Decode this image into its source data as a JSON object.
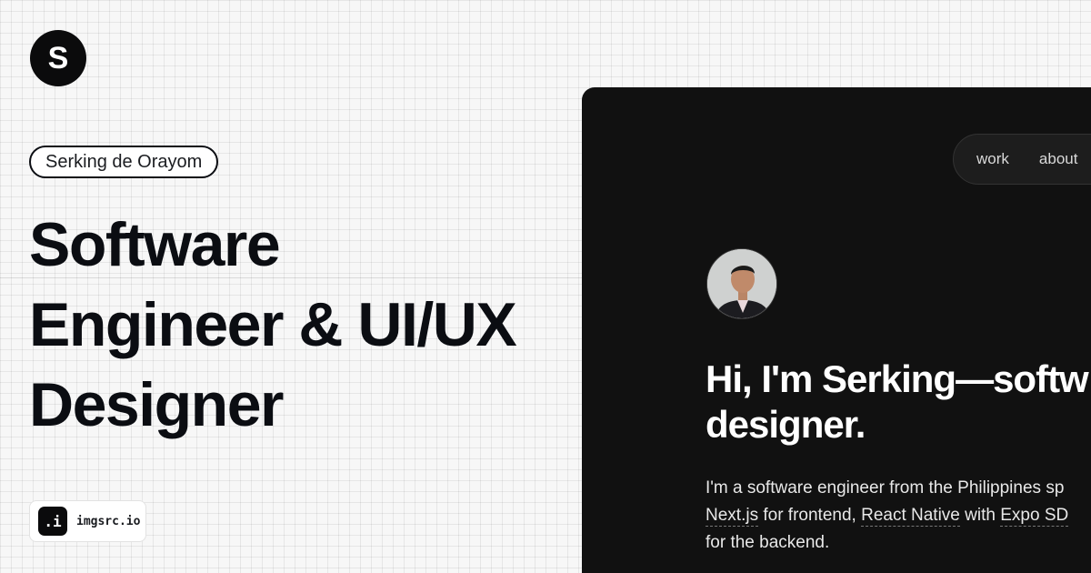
{
  "brand": {
    "logo_letter": "S"
  },
  "name_pill": "Serking de Orayom",
  "headline": [
    "Software",
    "Engineer & UI/UX",
    "Designer"
  ],
  "badge": {
    "icon_text": ".i",
    "label": "imgsrc.io"
  },
  "preview": {
    "nav": [
      {
        "label": "work"
      },
      {
        "label": "about"
      }
    ],
    "hero": [
      "Hi, I'm Serking—softw",
      "designer."
    ],
    "bio": {
      "line1": "I'm a software engineer from the Philippines sp",
      "nextjs": "Next.js",
      "for_frontend": " for frontend, ",
      "react_native": "React Native",
      "with": " with ",
      "expo": "Expo SD",
      "line3": "for the backend."
    }
  },
  "colors": {
    "panel_bg": "#111111",
    "ink": "#0b0d12",
    "page_bg": "#f7f7f7"
  }
}
